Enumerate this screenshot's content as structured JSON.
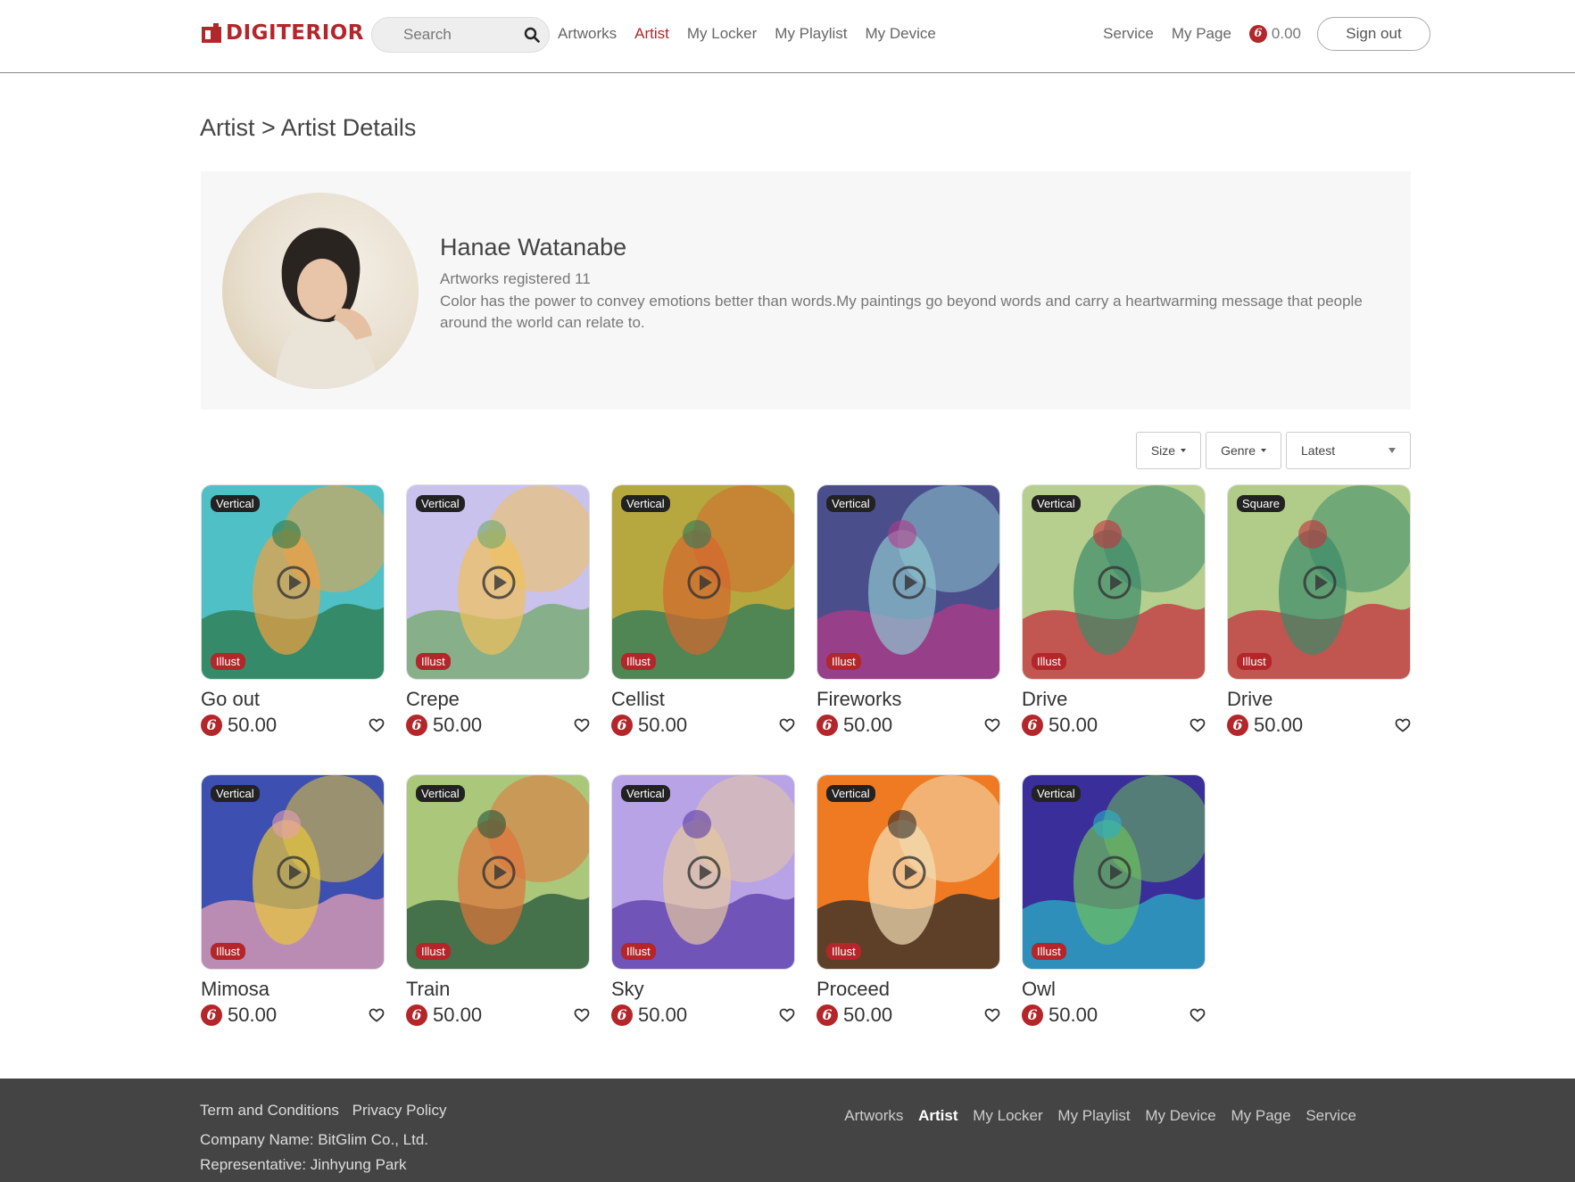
{
  "header": {
    "logo_text": "DIGITERIOR",
    "search_placeholder": "Search",
    "nav": [
      "Artworks",
      "Artist",
      "My Locker",
      "My Playlist",
      "My Device"
    ],
    "active_nav": "Artist",
    "service": "Service",
    "my_page": "My Page",
    "balance": "0.00",
    "sign_out": "Sign out"
  },
  "breadcrumb": "Artist > Artist Details",
  "profile": {
    "name": "Hanae Watanabe",
    "count": "Artworks registered 11",
    "bio": "Color has the power to convey emotions better than words.My paintings go beyond words and carry a heartwarming message that people around the world can relate to."
  },
  "filters": {
    "size": "Size",
    "genre": "Genre",
    "sort": "Latest"
  },
  "artworks": [
    {
      "title": "Go out",
      "price": "50.00",
      "orientation": "Vertical",
      "genre": "Illust",
      "colors": [
        "#4ec0c6",
        "#f2a040",
        "#2d7a4a"
      ]
    },
    {
      "title": "Crepe",
      "price": "50.00",
      "orientation": "Vertical",
      "genre": "Illust",
      "colors": [
        "#c9c2ec",
        "#f1c15a",
        "#6fa86a"
      ]
    },
    {
      "title": "Cellist",
      "price": "50.00",
      "orientation": "Vertical",
      "genre": "Illust",
      "colors": [
        "#b6a83e",
        "#d4662e",
        "#2e7a5c"
      ]
    },
    {
      "title": "Fireworks",
      "price": "50.00",
      "orientation": "Vertical",
      "genre": "Illust",
      "colors": [
        "#4a4f8c",
        "#8ec6cf",
        "#b33a8a"
      ]
    },
    {
      "title": "Drive",
      "price": "50.00",
      "orientation": "Vertical",
      "genre": "Illust",
      "colors": [
        "#b6cf8e",
        "#3c8a6a",
        "#c62f3c"
      ]
    },
    {
      "title": "Drive",
      "price": "50.00",
      "orientation": "Square",
      "genre": "Illust",
      "colors": [
        "#b0cc88",
        "#3c8a6a",
        "#c62f3c"
      ]
    },
    {
      "title": "Mimosa",
      "price": "50.00",
      "orientation": "Vertical",
      "genre": "Illust",
      "colors": [
        "#3d4fb0",
        "#e8c83c",
        "#e6a0b4"
      ]
    },
    {
      "title": "Train",
      "price": "50.00",
      "orientation": "Vertical",
      "genre": "Illust",
      "colors": [
        "#aac77a",
        "#e0733a",
        "#24553c"
      ]
    },
    {
      "title": "Sky",
      "price": "50.00",
      "orientation": "Vertical",
      "genre": "Illust",
      "colors": [
        "#b8a3e6",
        "#e6c8a0",
        "#5a3aa8"
      ]
    },
    {
      "title": "Proceed",
      "price": "50.00",
      "orientation": "Vertical",
      "genre": "Illust",
      "colors": [
        "#f07a22",
        "#f3e0b6",
        "#2e2c2a"
      ]
    },
    {
      "title": "Owl",
      "price": "50.00",
      "orientation": "Vertical",
      "genre": "Illust",
      "colors": [
        "#3a2e9a",
        "#6cbf5c",
        "#2cb0c6"
      ]
    }
  ],
  "footer": {
    "links": [
      "Term and Conditions",
      "Privacy Policy"
    ],
    "company": "Company Name: BitGlim Co., Ltd.",
    "representative": "Representative: Jinhyung Park",
    "nav": [
      "Artworks",
      "Artist",
      "My Locker",
      "My Playlist",
      "My Device",
      "My Page",
      "Service"
    ],
    "active_nav": "Artist"
  },
  "colors": {
    "brand": "#b3262a",
    "footer_bg": "#444444",
    "profile_bg": "#f7f7f7"
  }
}
